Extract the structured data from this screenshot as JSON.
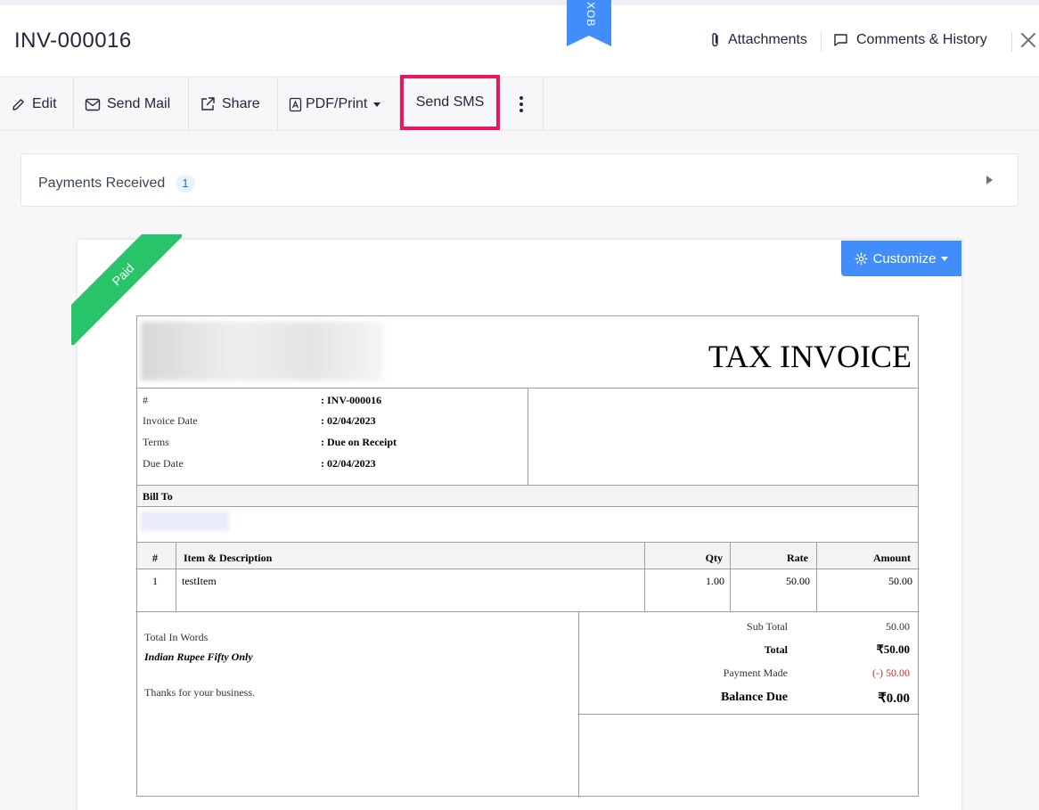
{
  "header": {
    "title": "INV-000016",
    "sandbox_label": "XOB",
    "attachments_label": "Attachments",
    "comments_label": "Comments & History"
  },
  "toolbar": {
    "edit_label": "Edit",
    "send_mail_label": "Send Mail",
    "share_label": "Share",
    "pdf_print_label": "PDF/Print",
    "send_sms_label": "Send SMS"
  },
  "payments": {
    "label": "Payments Received",
    "count": "1"
  },
  "status_ribbon": "Paid",
  "customize_label": "Customize",
  "invoice": {
    "doc_title": "TAX INVOICE",
    "meta": [
      {
        "label": "#",
        "value": ": INV-000016"
      },
      {
        "label": "Invoice Date",
        "value": ": 02/04/2023"
      },
      {
        "label": "Terms",
        "value": ": Due on Receipt"
      },
      {
        "label": "Due Date",
        "value": ": 02/04/2023"
      }
    ],
    "bill_to_label": "Bill To",
    "columns": {
      "num": "#",
      "item": "Item & Description",
      "qty": "Qty",
      "rate": "Rate",
      "amount": "Amount"
    },
    "items": [
      {
        "num": "1",
        "item": "testItem",
        "qty": "1.00",
        "rate": "50.00",
        "amount": "50.00"
      }
    ],
    "total_in_words_label": "Total In Words",
    "total_in_words": "Indian Rupee Fifty Only",
    "notes": "Thanks for your business.",
    "sub_total_label": "Sub Total",
    "sub_total": "50.00",
    "total_label": "Total",
    "total": "₹50.00",
    "payment_made_label": "Payment Made",
    "payment_made": "(-) 50.00",
    "balance_due_label": "Balance Due",
    "balance_due": "₹0.00"
  },
  "colors": {
    "accent": "#408dfb",
    "paid_ribbon": "#27c46a",
    "highlight": "#e8185c",
    "negative": "#d6281f"
  }
}
